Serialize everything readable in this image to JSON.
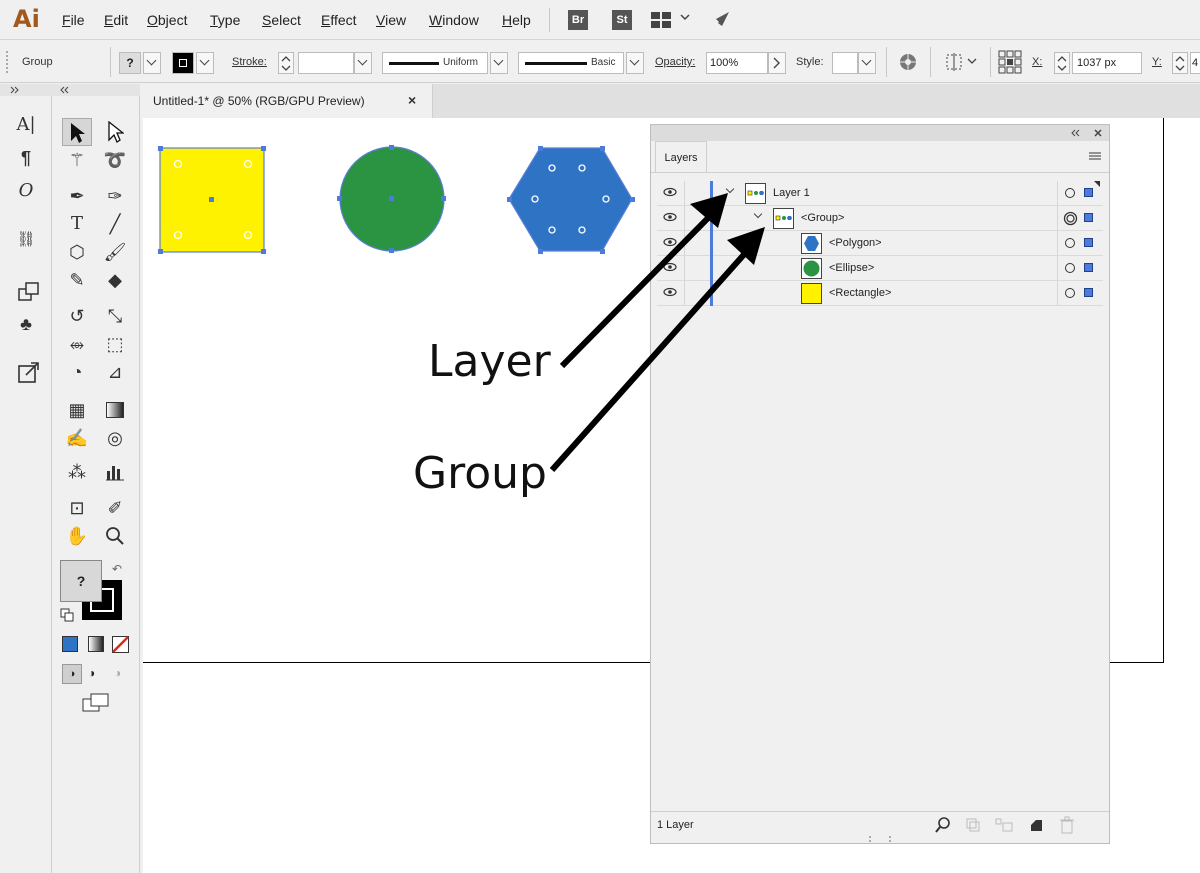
{
  "app": {
    "logo": "Ai"
  },
  "menu": [
    {
      "label": "File"
    },
    {
      "label": "Edit"
    },
    {
      "label": "Object"
    },
    {
      "label": "Type"
    },
    {
      "label": "Select"
    },
    {
      "label": "Effect"
    },
    {
      "label": "View"
    },
    {
      "label": "Window"
    },
    {
      "label": "Help"
    }
  ],
  "badges": {
    "bridge": "Br",
    "stock": "St"
  },
  "control_bar": {
    "selection_label": "Group",
    "fill_placeholder": "?",
    "stroke_label": "Stroke:",
    "stroke_profile": "Uniform",
    "brush": "Basic",
    "opacity_label": "Opacity:",
    "opacity_value": "100%",
    "style_label": "Style:",
    "x_label": "X:",
    "x_value": "1037 px",
    "y_label": "Y:",
    "y_value": "4"
  },
  "document_tab": {
    "title": "Untitled-1* @ 50% (RGB/GPU Preview)",
    "close": "×"
  },
  "toolbar": {
    "fill_placeholder": "?"
  },
  "layers_panel": {
    "tab": "Layers",
    "rows": [
      {
        "name": "Layer 1",
        "thumb": "layer"
      },
      {
        "name": "<Group>",
        "thumb": "group"
      },
      {
        "name": "<Polygon>",
        "thumb": "polygon"
      },
      {
        "name": "<Ellipse>",
        "thumb": "ellipse"
      },
      {
        "name": "<Rectangle>",
        "thumb": "rectangle"
      }
    ],
    "footer_count": "1 Layer"
  },
  "callouts": {
    "layer": "Layer",
    "group": "Group"
  },
  "colors": {
    "rect_fill": "#fff200",
    "ellipse_fill": "#2b9443",
    "polygon_fill": "#2f74c4",
    "selection": "#4c7bd9"
  }
}
